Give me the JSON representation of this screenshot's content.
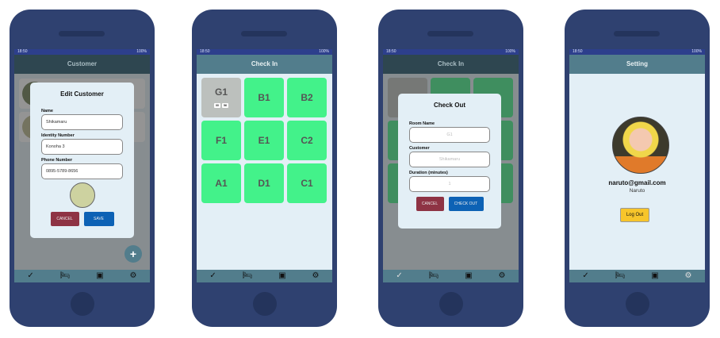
{
  "status": {
    "time": "18:50",
    "battery": "100%"
  },
  "nav_icons": [
    "check-circle-icon",
    "bed-icon",
    "id-card-icon",
    "gear-icon"
  ],
  "nav_glyphs": [
    "✓",
    "🛏",
    "▣",
    "⚙"
  ],
  "screen1": {
    "header": "Customer",
    "dialog": {
      "title": "Edit Customer",
      "name_label": "Name",
      "name_value": "Shikamaru",
      "id_label": "Identity Number",
      "id_value": "Konoha 3",
      "phone_label": "Phone Number",
      "phone_value": "0895-5789-8656",
      "cancel": "CANCEL",
      "save": "SAVE"
    },
    "fab": "+"
  },
  "screen2": {
    "header": "Check In",
    "rooms": [
      {
        "name": "G1",
        "occupied": true,
        "timer": [
          "00",
          "56"
        ]
      },
      {
        "name": "B1"
      },
      {
        "name": "B2"
      },
      {
        "name": "F1"
      },
      {
        "name": "E1"
      },
      {
        "name": "C2"
      },
      {
        "name": "A1"
      },
      {
        "name": "D1"
      },
      {
        "name": "C1"
      }
    ]
  },
  "screen3": {
    "header": "Check In",
    "dialog": {
      "title": "Check Out",
      "room_label": "Room Name",
      "room_value": "G1",
      "customer_label": "Customer",
      "customer_value": "Shikamaru",
      "duration_label": "Duration (minutes)",
      "duration_value": "1",
      "cancel": "CANCEL",
      "checkout": "CHECK OUT"
    }
  },
  "screen4": {
    "header": "Setting",
    "email": "naruto@gmail.com",
    "name": "Naruto",
    "logout": "Log Out"
  },
  "colors": {
    "phone": "#2f4170",
    "header": "#527d8c",
    "tile": "#43f28a",
    "cancel": "#8e3344",
    "primary": "#0d62b5",
    "logout": "#f7c52b"
  }
}
